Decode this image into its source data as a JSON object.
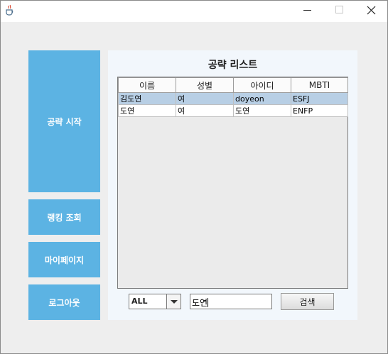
{
  "window": {
    "minimize_icon": "minimize-icon",
    "maximize_icon": "maximize-icon",
    "close_icon": "close-icon"
  },
  "sidebar": {
    "start_label": "공략 시작",
    "ranking_label": "랭킹 조회",
    "mypage_label": "마이페이지",
    "logout_label": "로그아웃",
    "color": "#5cb3e3"
  },
  "panel": {
    "title": "공략 리스트",
    "background": "#f2f7fc"
  },
  "table": {
    "columns": [
      "이름",
      "성별",
      "아이디",
      "MBTI"
    ],
    "rows": [
      [
        "김도연",
        "여",
        "doyeon",
        "ESFJ"
      ],
      [
        "도연",
        "여",
        "도연",
        "ENFP"
      ]
    ],
    "selected_row": 0,
    "selected_color": "#b8cfe5"
  },
  "filter": {
    "selected": "ALL"
  },
  "search": {
    "value": "도연",
    "button_label": "검색"
  }
}
